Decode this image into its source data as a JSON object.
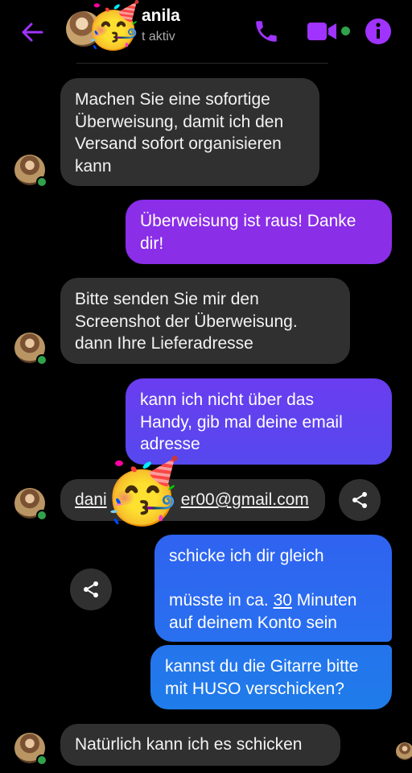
{
  "header": {
    "contact_name": "anila",
    "status": "t aktiv",
    "party_emoji": "🥳",
    "colors": {
      "accent": "#a033ff",
      "online": "#31a24c"
    },
    "icons": [
      "back-arrow-icon",
      "phone-call-icon",
      "video-camera-icon",
      "info-icon"
    ]
  },
  "messages": [
    {
      "sender": "contact",
      "text_lines": [
        "Machen Sie eine sofortige",
        "Überweisung, damit ich den",
        "Versand sofort organisieren",
        "kann"
      ]
    },
    {
      "sender": "me",
      "text_lines": [
        "Überweisung ist raus! Danke",
        "dir!"
      ]
    },
    {
      "sender": "contact",
      "text_lines": [
        "Bitte senden Sie mir den",
        "Screenshot der Überweisung.",
        "dann Ihre Lieferadresse"
      ]
    },
    {
      "sender": "me",
      "text_lines": [
        "kann ich nicht über das",
        "Handy, gib mal deine email",
        "adresse"
      ]
    },
    {
      "sender": "contact",
      "text": "dani",
      "text_tail": "er00@gmail.com",
      "party_emoji": "🥳"
    },
    {
      "sender": "me",
      "line1": "schicke ich dir gleich",
      "line2_before": "müsste in ca. ",
      "line2_num": "30",
      "line2_after": " Minuten",
      "line3": "auf deinem Konto sein"
    },
    {
      "sender": "me",
      "text_lines": [
        "kannst du die Gitarre bitte",
        "mit HUSO verschicken?"
      ]
    },
    {
      "sender": "contact",
      "text": "Natürlich kann ich es schicken"
    }
  ]
}
